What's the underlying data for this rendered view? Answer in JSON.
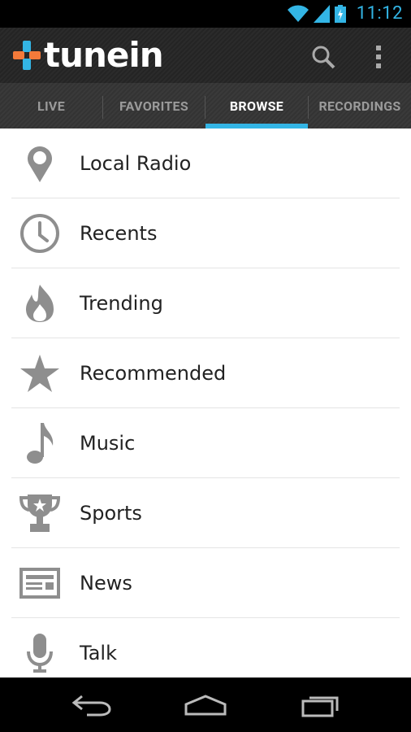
{
  "status_bar": {
    "time": "11:12"
  },
  "app": {
    "logo_text": "tunein"
  },
  "tabs": [
    {
      "label": "LIVE"
    },
    {
      "label": "FAVORITES"
    },
    {
      "label": "BROWSE"
    },
    {
      "label": "RECORDINGS"
    }
  ],
  "active_tab": "BROWSE",
  "browse_items": [
    {
      "label": "Local Radio",
      "icon": "location-pin-icon"
    },
    {
      "label": "Recents",
      "icon": "clock-icon"
    },
    {
      "label": "Trending",
      "icon": "flame-icon"
    },
    {
      "label": "Recommended",
      "icon": "star-icon"
    },
    {
      "label": "Music",
      "icon": "music-note-icon"
    },
    {
      "label": "Sports",
      "icon": "trophy-icon"
    },
    {
      "label": "News",
      "icon": "newspaper-icon"
    },
    {
      "label": "Talk",
      "icon": "microphone-icon"
    }
  ],
  "colors": {
    "accent": "#33b5e5",
    "icon_gray": "#8e8e8e"
  }
}
